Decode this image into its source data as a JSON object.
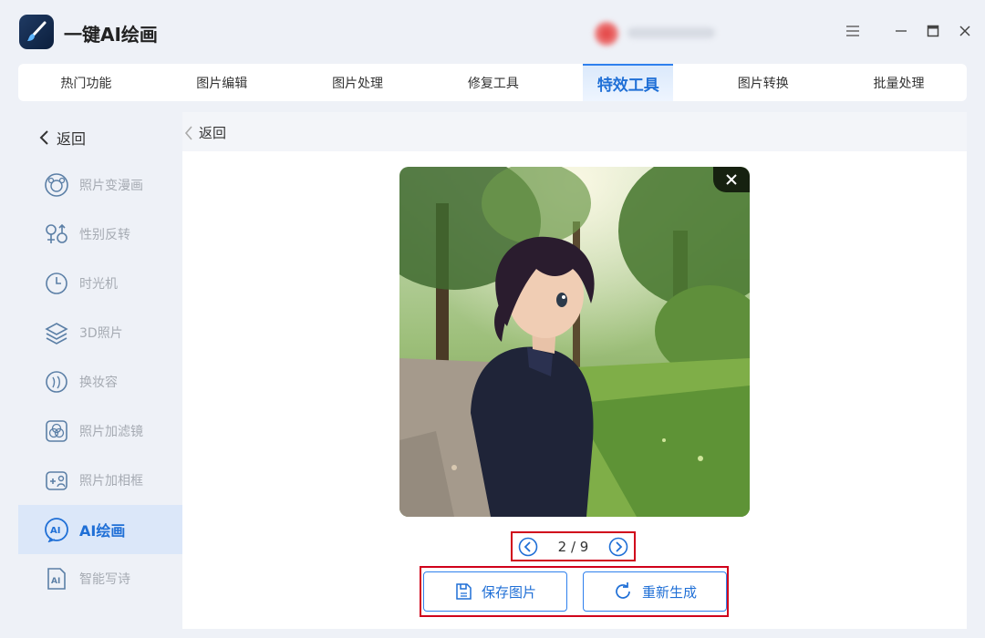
{
  "app": {
    "title": "一键AI绘画"
  },
  "tabs": [
    {
      "label": "热门功能"
    },
    {
      "label": "图片编辑"
    },
    {
      "label": "图片处理"
    },
    {
      "label": "修复工具"
    },
    {
      "label": "特效工具",
      "active": true
    },
    {
      "label": "图片转换"
    },
    {
      "label": "批量处理"
    }
  ],
  "sidebar": {
    "back_label": "返回",
    "items": [
      {
        "label": "照片变漫画",
        "icon": "bear-face-icon"
      },
      {
        "label": "性别反转",
        "icon": "gender-icon"
      },
      {
        "label": "时光机",
        "icon": "clock-icon"
      },
      {
        "label": "3D照片",
        "icon": "layers-icon"
      },
      {
        "label": "换妆容",
        "icon": "face-profile-icon"
      },
      {
        "label": "照片加滤镜",
        "icon": "filter-icon"
      },
      {
        "label": "照片加相框",
        "icon": "frame-icon"
      },
      {
        "label": "AI绘画",
        "icon": "ai-bubble-icon",
        "active": true
      },
      {
        "label": "智能写诗",
        "icon": "ai-doc-icon"
      }
    ]
  },
  "main": {
    "back_label": "返回",
    "pager": {
      "current": "2 / 9"
    },
    "save_label": "保存图片",
    "regen_label": "重新生成"
  },
  "colors": {
    "accent": "#1f6fd6",
    "highlight_box": "#d0021b",
    "active_tab_bg": "#dbe9fb"
  }
}
